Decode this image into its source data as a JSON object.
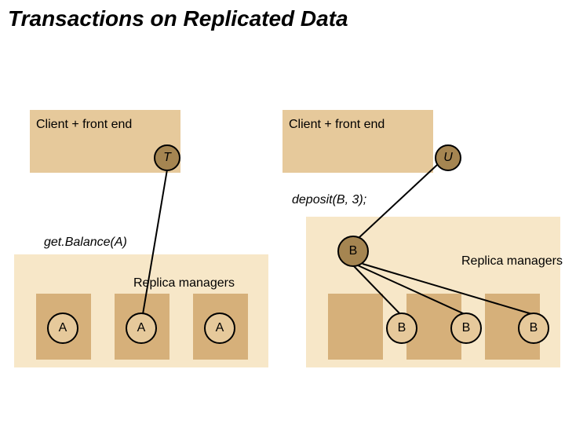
{
  "title": "Transactions on Replicated Data",
  "left": {
    "client_label": "Client + front end",
    "tx_label": "T",
    "op_label": "get.Balance(A)",
    "replica_label": "Replica managers",
    "nodes": [
      "A",
      "A",
      "A"
    ]
  },
  "right": {
    "client_label": "Client + front end",
    "tx_label": "U",
    "op_label": "deposit(B, 3);",
    "b_top_label": "B",
    "replica_label": "Replica managers",
    "nodes": [
      "B",
      "B",
      "B"
    ]
  },
  "colors": {
    "box": "#e6c99b",
    "large_box": "#f7e7c8",
    "med_box": "#d6b07a",
    "disc_dark": "#a58551",
    "disc_light": "#e6c99b"
  }
}
